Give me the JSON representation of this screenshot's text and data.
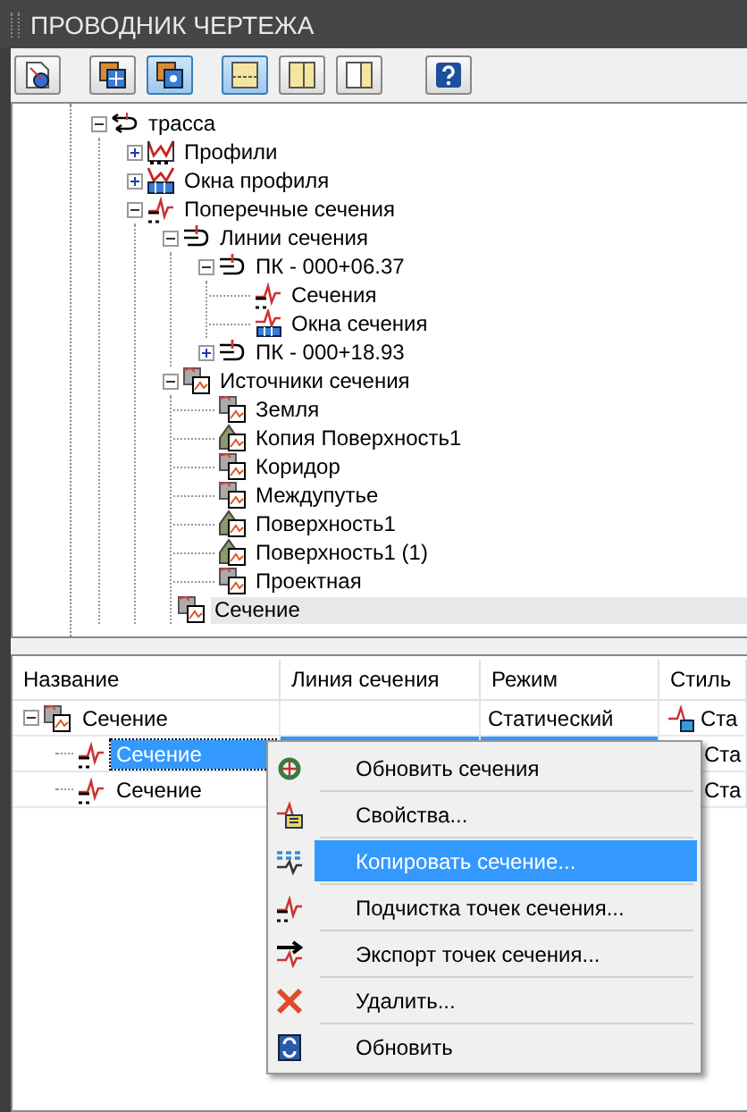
{
  "window": {
    "title": "ПРОВОДНИК ЧЕРТЕЖА"
  },
  "toolbar": [
    {
      "kind": "drawing",
      "selected": false
    },
    {
      "kind": "panel",
      "selected": false
    },
    {
      "kind": "panel-alt",
      "selected": true
    },
    {
      "kind": "split-h",
      "selected": true
    },
    {
      "kind": "split-v",
      "selected": false
    },
    {
      "kind": "split-v2",
      "selected": false
    },
    {
      "kind": "help",
      "selected": false
    }
  ],
  "tree": [
    {
      "label": "трасса",
      "kind": "alignment",
      "expanded": true,
      "selected": false,
      "children": [
        {
          "label": "Профили",
          "kind": "profile",
          "expanded": false,
          "selected": false
        },
        {
          "label": "Окна профиля",
          "kind": "profile-view",
          "expanded": false,
          "selected": false
        },
        {
          "label": "Поперечные сечения",
          "kind": "section",
          "expanded": true,
          "selected": false,
          "children": [
            {
              "label": "Линии сечения",
              "kind": "sample-line",
              "expanded": true,
              "selected": false,
              "children": [
                {
                  "label": "ПК - 000+06.37",
                  "kind": "sample-line",
                  "expanded": true,
                  "selected": false,
                  "children": [
                    {
                      "label": "Сечения",
                      "kind": "section",
                      "selected": false
                    },
                    {
                      "label": "Окна сечения",
                      "kind": "section-view",
                      "selected": false
                    }
                  ]
                },
                {
                  "label": "ПК - 000+18.93",
                  "kind": "sample-line",
                  "expanded": false,
                  "selected": false
                }
              ]
            },
            {
              "label": "Источники сечения",
              "kind": "source",
              "expanded": true,
              "selected": false,
              "children": [
                {
                  "label": "Земля",
                  "kind": "source",
                  "selected": false
                },
                {
                  "label": "Копия Поверхность1",
                  "kind": "surface",
                  "selected": false
                },
                {
                  "label": "Коридор",
                  "kind": "source",
                  "selected": false
                },
                {
                  "label": "Междупутье",
                  "kind": "source",
                  "selected": false
                },
                {
                  "label": "Поверхность1",
                  "kind": "surface",
                  "selected": false
                },
                {
                  "label": "Поверхность1 (1)",
                  "kind": "surface",
                  "selected": false
                },
                {
                  "label": "Проектная",
                  "kind": "source",
                  "selected": false
                },
                {
                  "label": "Сечение",
                  "kind": "source",
                  "selected": true
                }
              ]
            }
          ]
        }
      ]
    }
  ],
  "table": {
    "columns": [
      "Название",
      "Линия сечения",
      "Режим",
      "Стиль"
    ],
    "rows": [
      {
        "name": "Сечение",
        "kind": "source",
        "expanded": true,
        "selected": false,
        "mode": "Статический",
        "style": "Ста",
        "style_icon": true
      },
      {
        "name": "Сечение",
        "kind": "section",
        "selected": true,
        "style": "Ста",
        "style_icon": false
      },
      {
        "name": "Сечение",
        "kind": "section",
        "selected": false,
        "style": "Ста",
        "style_icon": false
      }
    ]
  },
  "context_menu": [
    {
      "label": "Обновить сечения",
      "kind": "refresh",
      "selected": false
    },
    {
      "label": "Свойства...",
      "kind": "properties",
      "selected": false
    },
    {
      "label": "Копировать сечение...",
      "kind": "copy",
      "selected": true
    },
    {
      "label": "Подчистка точек сечения...",
      "kind": "section",
      "selected": false
    },
    {
      "label": "Экспорт точек сечения...",
      "kind": "export",
      "selected": false
    },
    {
      "label": "Удалить...",
      "kind": "delete",
      "selected": false
    },
    {
      "label": "Обновить",
      "kind": "update",
      "selected": false
    }
  ]
}
